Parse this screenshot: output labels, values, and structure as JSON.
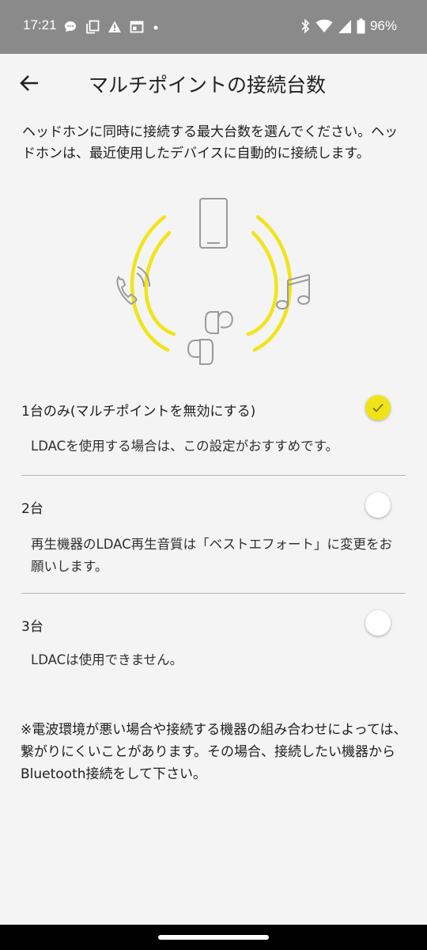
{
  "status_bar": {
    "time": "17:21",
    "battery": "96%",
    "left_icons": [
      "chat-icon",
      "copy-icon",
      "warning-icon",
      "calendar-icon",
      "dot-icon"
    ],
    "right_icons": [
      "bluetooth-icon",
      "wifi-icon",
      "signal-icon",
      "battery-icon"
    ]
  },
  "app_bar": {
    "title": "マルチポイントの接続台数",
    "back_icon": "arrow-back-icon"
  },
  "description": "ヘッドホンに同時に接続する最大台数を選んでください。ヘッドホンは、最近使用したデバイスに自動的に接続します。",
  "illustration": {
    "icons": [
      "smartphone-icon",
      "phone-call-icon",
      "music-note-icon",
      "earbuds-icon"
    ],
    "accent_color": "#f1e41a"
  },
  "options": [
    {
      "label": "1台のみ(マルチポイントを無効にする)",
      "description": "LDACを使用する場合は、この設定がおすすめです。",
      "selected": true
    },
    {
      "label": "2台",
      "description": "再生機器のLDAC再生音質は「ベストエフォート」に変更をお願いします。",
      "selected": false
    },
    {
      "label": "3台",
      "description": "LDACは使用できません。",
      "selected": false
    }
  ],
  "note": "※電波環境が悪い場合や接続する機器の組み合わせによっては、繋がりにくいことがあります。その場合、接続したい機器からBluetooth接続をして下さい。",
  "colors": {
    "status_bar": "#8a8a8a",
    "background": "#f4f4f4",
    "accent": "#f0e419"
  }
}
